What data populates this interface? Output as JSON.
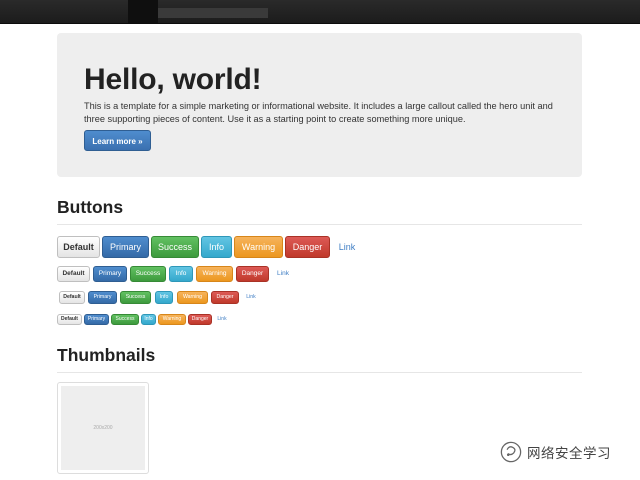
{
  "hero": {
    "title": "Hello, world!",
    "body": "This is a template for a simple marketing or informational website. It includes a large callout called the hero unit and three supporting pieces of content. Use it as a starting point to create something more unique.",
    "button_label": "Learn more »"
  },
  "buttons_section": {
    "title": "Buttons",
    "labels": {
      "default": "Default",
      "primary": "Primary",
      "success": "Success",
      "info": "Info",
      "warning": "Warning",
      "danger": "Danger",
      "link": "Link"
    }
  },
  "thumbnails_section": {
    "title": "Thumbnails",
    "thumbnail_text": "200x200"
  },
  "watermark": {
    "text": "网络安全学习",
    "icon": "wechat-icon"
  },
  "colors": {
    "navbar": "#1c1c1c",
    "hero_bg": "#eeeeee",
    "primary": "#3a70b0",
    "success": "#4cae4c",
    "info": "#46b8da",
    "warning": "#f0a030",
    "danger": "#c9302c",
    "link": "#3f7ec4"
  }
}
